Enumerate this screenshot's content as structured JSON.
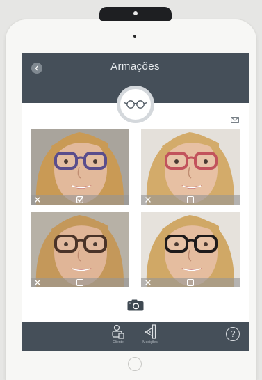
{
  "header": {
    "title": "Armações"
  },
  "tiles": [
    {
      "remove_symbol": "✕",
      "checked": true,
      "frame_color": "#5a4d8c",
      "hair_color": "#c99a55",
      "skin_color": "#e2b99b",
      "background_color": "#a9a49c"
    },
    {
      "remove_symbol": "✕",
      "checked": false,
      "frame_color": "#c2535c",
      "hair_color": "#d3ab6a",
      "skin_color": "#e7c0a3",
      "background_color": "#e4e0da"
    },
    {
      "remove_symbol": "✕",
      "checked": false,
      "frame_color": "#4a3328",
      "hair_color": "#c4985a",
      "skin_color": "#e0b597",
      "background_color": "#b7b1a6"
    },
    {
      "remove_symbol": "✕",
      "checked": false,
      "frame_color": "#1e1a1a",
      "hair_color": "#d0a866",
      "skin_color": "#e5bd9f",
      "background_color": "#e6e2dc"
    }
  ],
  "footer": {
    "items": [
      {
        "label": "Cliente"
      },
      {
        "label": "Medições"
      }
    ],
    "help_symbol": "?"
  },
  "colors": {
    "header_bg": "#454f59",
    "screen_bg": "#ffffff",
    "device_bg": "#f7f7f5"
  },
  "icons": [
    "back-arrow-icon",
    "glasses-icon",
    "mail-icon",
    "close-icon",
    "checkbox-icon",
    "camera-icon",
    "client-icon",
    "measure-icon",
    "help-icon"
  ]
}
